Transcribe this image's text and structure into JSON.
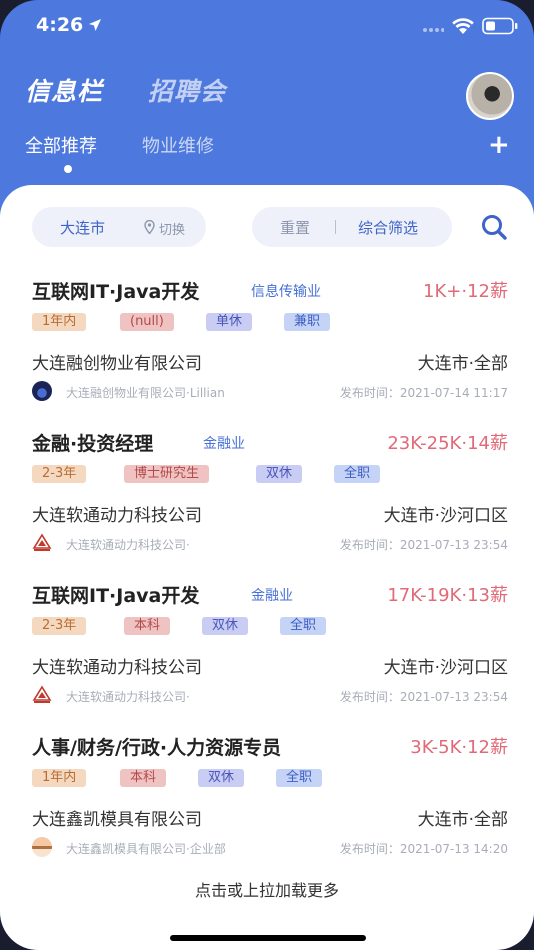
{
  "status_bar": {
    "time": "4:26"
  },
  "header": {
    "tab_main": "信息栏",
    "tab_alt": "招聘会"
  },
  "sub_tabs": [
    {
      "label": "全部推荐"
    },
    {
      "label": "物业维修"
    }
  ],
  "add_tab_label": "+",
  "filter": {
    "city": "大连市",
    "switch_label": "切换",
    "reset": "重置",
    "combo": "综合筛选"
  },
  "jobs": [
    {
      "title": "互联网IT·Java开发",
      "industry": "信息传输业",
      "salary": "1K+·12薪",
      "tags": [
        "1年内",
        "(null)",
        "单休",
        "兼职"
      ],
      "company": "大连融创物业有限公司",
      "location": "大连市·全部",
      "poster": "大连融创物业有限公司·Lillian",
      "date": "发布时间：2021-07-14 11:17"
    },
    {
      "title": "金融·投资经理",
      "industry": "金融业",
      "salary": "23K-25K·14薪",
      "tags": [
        "2-3年",
        "博士研究生",
        "双休",
        "全职"
      ],
      "company": "大连软通动力科技公司",
      "location": "大连市·沙河口区",
      "poster": "大连软通动力科技公司·",
      "date": "发布时间：2021-07-13 23:54"
    },
    {
      "title": "互联网IT·Java开发",
      "industry": "金融业",
      "salary": "17K-19K·13薪",
      "tags": [
        "2-3年",
        "本科",
        "双休",
        "全职"
      ],
      "company": "大连软通动力科技公司",
      "location": "大连市·沙河口区",
      "poster": "大连软通动力科技公司·",
      "date": "发布时间：2021-07-13 23:54"
    },
    {
      "title": "人事/财务/行政·人力资源专员",
      "industry": "",
      "salary": "3K-5K·12薪",
      "tags": [
        "1年内",
        "本科",
        "双休",
        "全职"
      ],
      "company": "大连鑫凯模具有限公司",
      "location": "大连市·全部",
      "poster": "大连鑫凯模具有限公司·企业部",
      "date": "发布时间：2021-07-13 14:20"
    }
  ],
  "load_more": "点击或上拉加载更多"
}
